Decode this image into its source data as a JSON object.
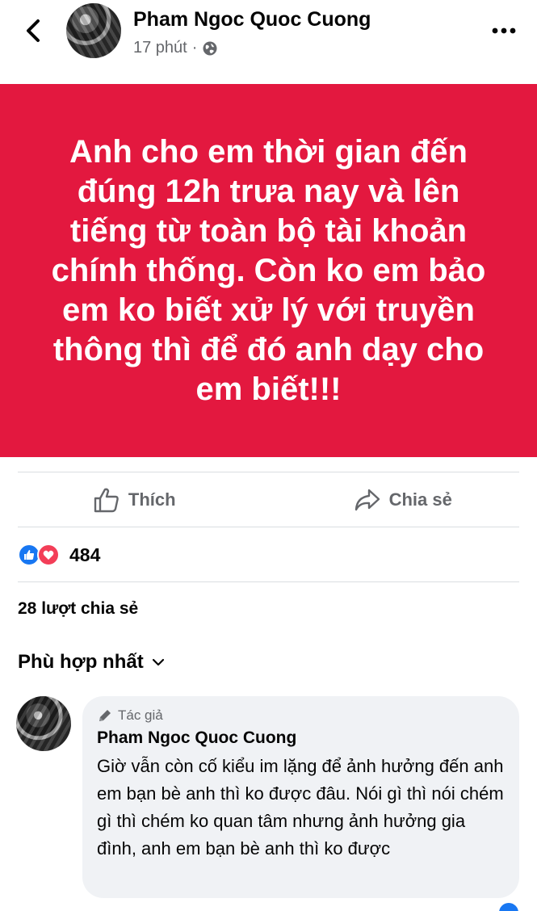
{
  "header": {
    "name": "Pham Ngoc Quoc Cuong",
    "time": "17 phút",
    "separator": "·"
  },
  "post": {
    "text": "Anh cho em thời gian đến đúng 12h trưa nay và lên tiếng từ toàn bộ tài khoản chính thống. Còn ko em bảo em ko biết xử lý với truyền thông thì để đó anh dạy cho em biết!!!",
    "background_color": "#e3183f"
  },
  "actions": {
    "like_label": "Thích",
    "share_label": "Chia sẻ"
  },
  "reactions": {
    "count": "484",
    "icons": [
      "like-icon",
      "love-icon"
    ]
  },
  "shares_text": "28 lượt chia sẻ",
  "sort_label": "Phù hợp nhất",
  "comment": {
    "badge": "Tác giả",
    "author": "Pham Ngoc Quoc Cuong",
    "text": "Giờ vẫn còn cố kiểu im lặng để ảnh hưởng đến anh em bạn bè anh thì ko được đâu. Nói gì thì nói chém gì thì chém ko quan tâm nhưng ảnh hưởng gia đình, anh em bạn bè anh thì ko được"
  },
  "colors": {
    "accent": "#1877f2",
    "love": "#f33e58",
    "muted": "#65676b"
  }
}
